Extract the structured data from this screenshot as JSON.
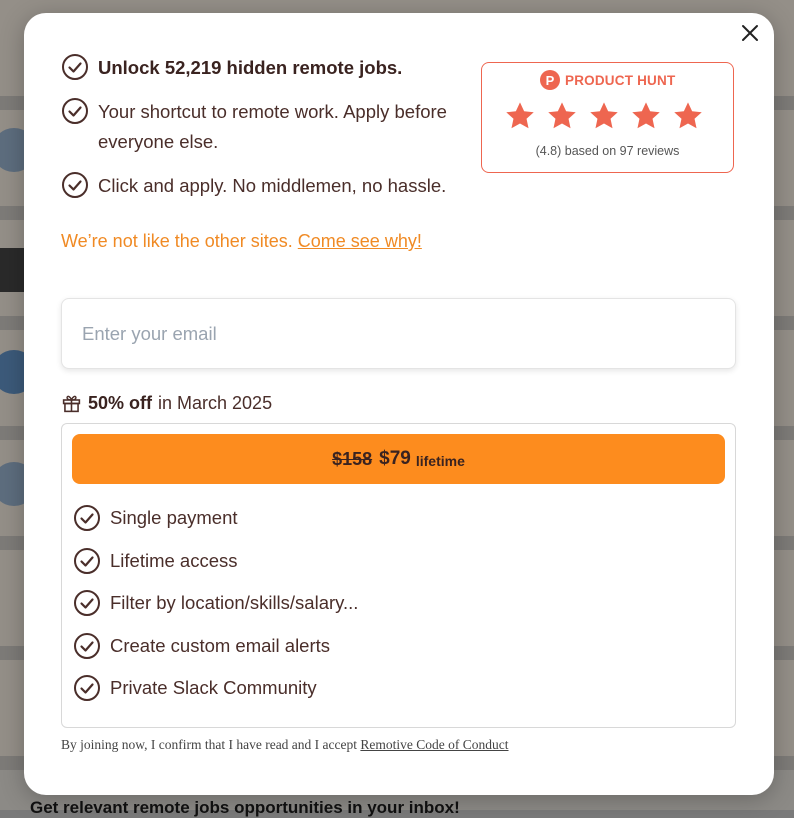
{
  "background": {
    "footer_text": "Get relevant remote jobs opportunities in your inbox!"
  },
  "modal": {
    "close_icon": "close-icon",
    "benefits": [
      {
        "text": "Unlock 52,219 hidden remote jobs.",
        "bold": true
      },
      {
        "text": "Your shortcut to remote work. Apply before everyone else.",
        "bold": false
      },
      {
        "text": "Click and apply. No middlemen, no hassle.",
        "bold": false
      }
    ],
    "product_hunt": {
      "logo_letter": "P",
      "title": "PRODUCT HUNT",
      "stars": 5,
      "rating_text": "(4.8) based on 97 reviews",
      "color": "#ee6650"
    },
    "tagline": {
      "text": "We’re not like the other sites. ",
      "link": "Come see why!"
    },
    "email": {
      "placeholder": "Enter your email",
      "value": ""
    },
    "offer": {
      "discount": "50% off",
      "period": "in March 2025"
    },
    "plan": {
      "old_price": "$158",
      "new_price": "$79",
      "term": "lifetime",
      "button_color": "#fd8c1e",
      "features": [
        "Single payment",
        "Lifetime access",
        "Filter by location/skills/salary...",
        "Create custom email alerts",
        "Private Slack Community"
      ]
    },
    "legal": {
      "text": "By joining now, I confirm that I have read and I accept ",
      "link": "Remotive Code of Conduct"
    }
  }
}
